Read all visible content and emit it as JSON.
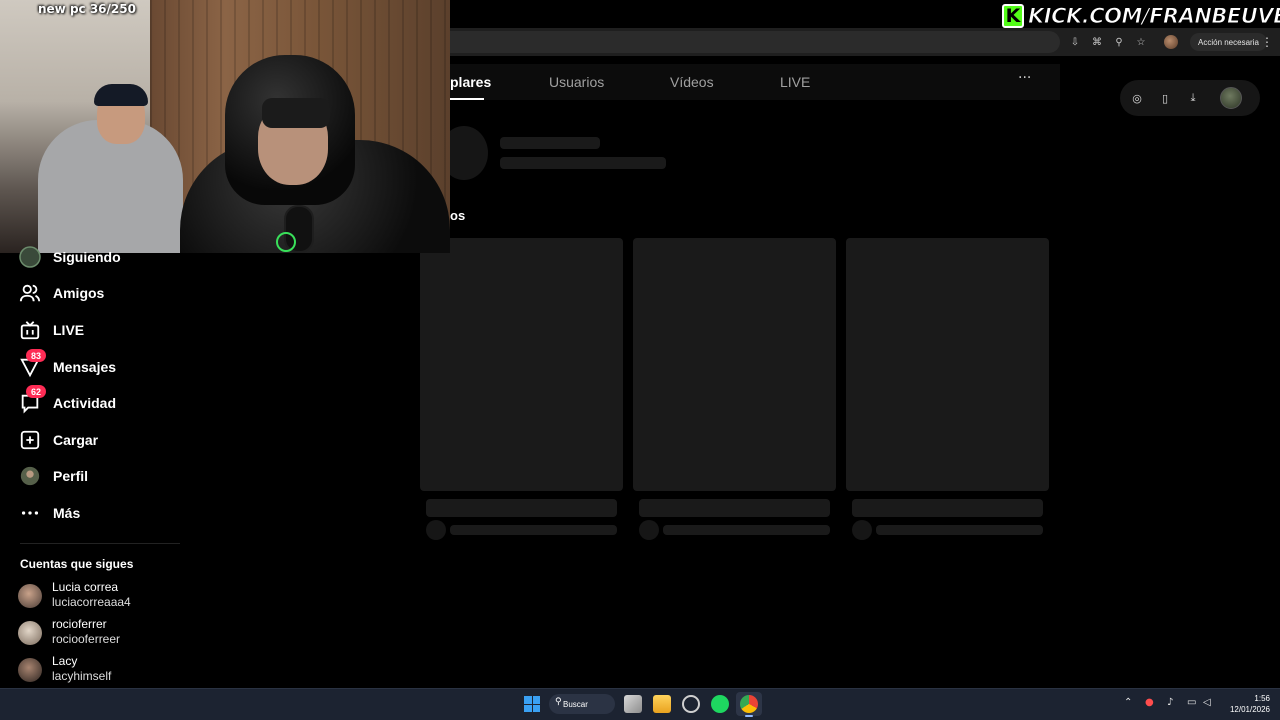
{
  "stream": {
    "overlay_caption": "new pc 36/250",
    "banner_text": "KICK.COM/FRANBEUVE"
  },
  "browser": {
    "action_required": "Acción necesaria"
  },
  "tabs": [
    {
      "label": "plares",
      "active": true
    },
    {
      "label": "Usuarios",
      "active": false
    },
    {
      "label": "Vídeos",
      "active": false
    },
    {
      "label": "LIVE",
      "active": false
    }
  ],
  "section_fragment": "os",
  "sidebar": {
    "items": [
      {
        "label": "Siguiendo",
        "icon": "following-avatar-icon",
        "badge": ""
      },
      {
        "label": "Amigos",
        "icon": "friends-icon",
        "badge": ""
      },
      {
        "label": "LIVE",
        "icon": "live-tv-icon",
        "badge": ""
      },
      {
        "label": "Mensajes",
        "icon": "messages-icon",
        "badge": "83"
      },
      {
        "label": "Actividad",
        "icon": "activity-icon",
        "badge": "62"
      },
      {
        "label": "Cargar",
        "icon": "upload-plus-icon",
        "badge": ""
      },
      {
        "label": "Perfil",
        "icon": "profile-avatar-icon",
        "badge": ""
      },
      {
        "label": "Más",
        "icon": "more-dots-icon",
        "badge": ""
      }
    ],
    "following_title": "Cuentas que sigues",
    "accounts": [
      {
        "name": "Lucia correa",
        "handle": "luciacorreaaa4"
      },
      {
        "name": "rocioferrer",
        "handle": "rociooferreer"
      },
      {
        "name": "Lacy",
        "handle": "lacyhimself"
      }
    ]
  },
  "taskbar": {
    "search_label": "Buscar",
    "time": "1:56",
    "date": "12/01/2026"
  },
  "colors": {
    "badge": "#fe2c55",
    "kick_green": "#53fc18",
    "background": "#000000"
  }
}
